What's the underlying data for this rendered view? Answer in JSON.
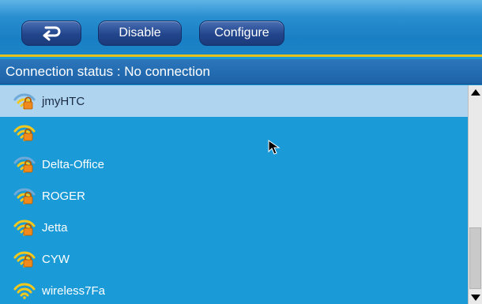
{
  "toolbar": {
    "back_icon": "return-arrow-icon",
    "disable_label": "Disable",
    "configure_label": "Configure"
  },
  "status": {
    "label": "Connection status",
    "separator": " : ",
    "value": "No connection"
  },
  "networks": [
    {
      "ssid": "jmyHTC",
      "secured": true,
      "signal": "medium",
      "selected": true
    },
    {
      "ssid": "",
      "secured": true,
      "signal": "full",
      "selected": false
    },
    {
      "ssid": "Delta-Office",
      "secured": true,
      "signal": "medium",
      "selected": false
    },
    {
      "ssid": "ROGER",
      "secured": true,
      "signal": "medium",
      "selected": false
    },
    {
      "ssid": "Jetta",
      "secured": true,
      "signal": "full",
      "selected": false
    },
    {
      "ssid": "CYW",
      "secured": true,
      "signal": "full",
      "selected": false
    },
    {
      "ssid": "wireless7Fa",
      "secured": false,
      "signal": "full",
      "selected": false
    }
  ],
  "colors": {
    "list_bg": "#1a9ad6",
    "selected_row": "#aed4ef",
    "toolbar_accent": "#e6c21c",
    "button": "#22458c",
    "wifi_active": "#f2c81e",
    "wifi_inactive": "#6fa9d8",
    "lock": "#f08a1c"
  },
  "icons": {
    "wifi": "wifi-signal-icon",
    "lock": "lock-icon",
    "scroll_up": "scroll-up-arrow-icon",
    "scroll_down": "scroll-down-arrow-icon",
    "cursor": "mouse-pointer-icon"
  }
}
